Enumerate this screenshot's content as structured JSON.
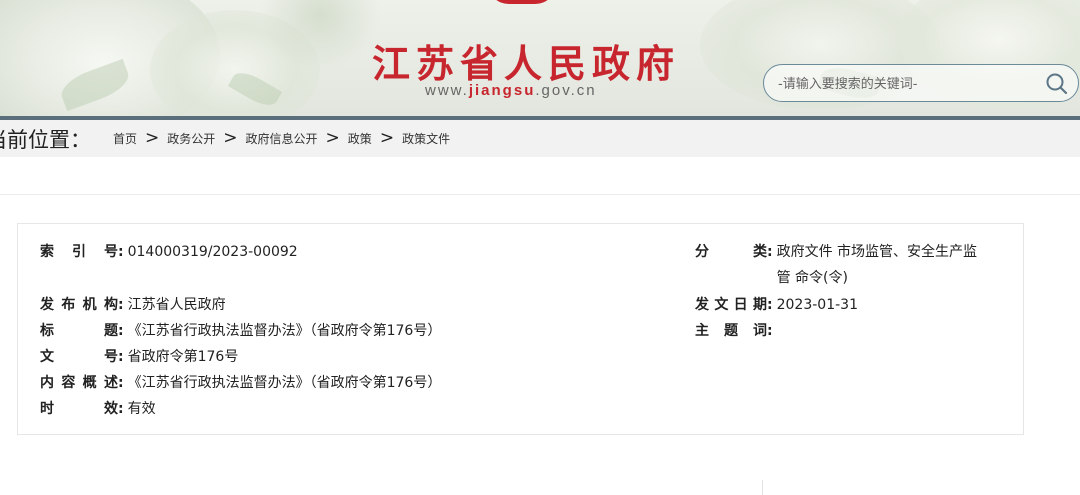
{
  "header": {
    "site_title": "江苏省人民政府",
    "url_prefix": "www.",
    "url_highlight": "jiangsu",
    "url_suffix": ".gov.cn",
    "brand_color": "#c8262e"
  },
  "search": {
    "placeholder": "-请输入要搜索的关键词-",
    "icon": "search-icon"
  },
  "breadcrumb": {
    "prefix": "当前位置：",
    "items": [
      "首页",
      "政务公开",
      "政府信息公开",
      "政策",
      "政策文件"
    ],
    "separator": ">"
  },
  "info": {
    "index_no": {
      "label": "索引号",
      "value": "014000319/2023-00092"
    },
    "publisher": {
      "label": "发布机构",
      "value": "江苏省人民政府"
    },
    "title": {
      "label": "标题",
      "value": "《江苏省行政执法监督办法》（省政府令第176号）"
    },
    "doc_no": {
      "label": "文号",
      "value": "省政府令第176号"
    },
    "summary": {
      "label": "内容概述",
      "value": "《江苏省行政执法监督办法》（省政府令第176号）"
    },
    "validity": {
      "label": "时效",
      "value": "有效"
    },
    "category": {
      "label": "分类",
      "value": "政府文件 市场监管、安全生产监管 命令(令)"
    },
    "issue_date": {
      "label": "发文日期",
      "value": "2023-01-31"
    },
    "keywords": {
      "label": "主题词",
      "value": ""
    }
  }
}
